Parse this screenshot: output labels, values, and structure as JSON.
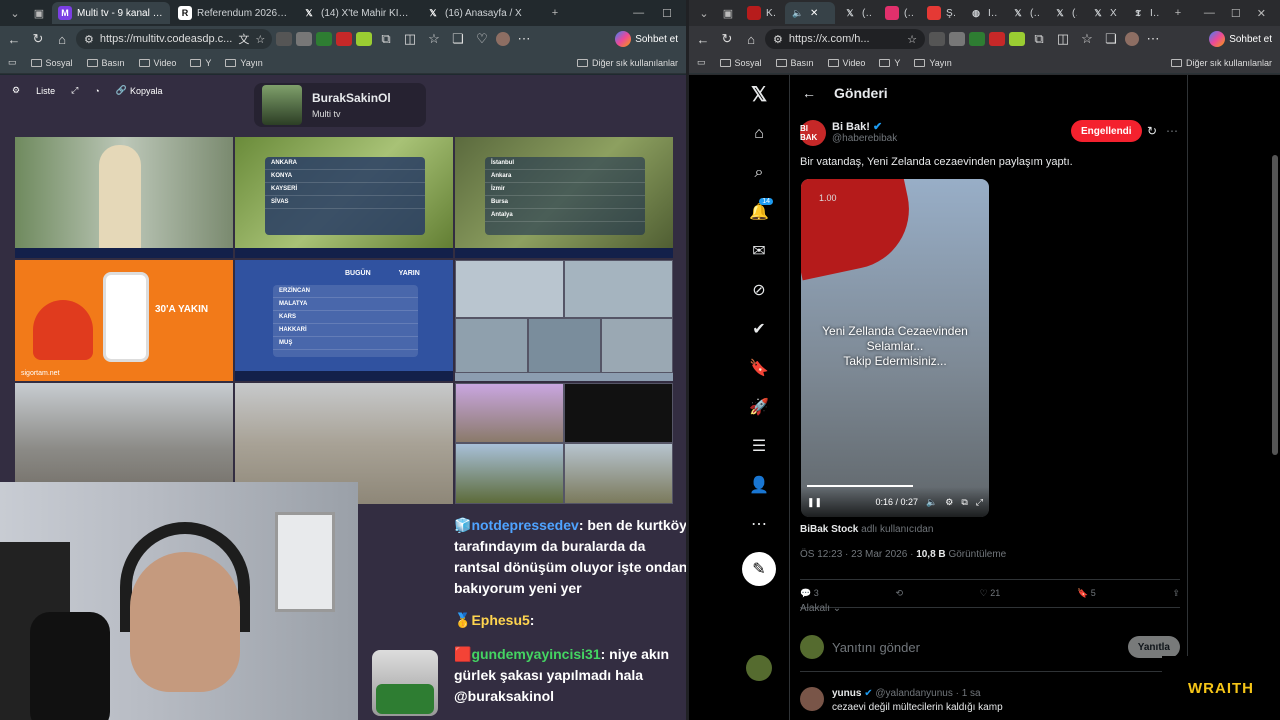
{
  "left_window": {
    "tabs": [
      {
        "label": "Multi tv - 9 kanal izleniy",
        "active": true
      },
      {
        "label": "Referendum 2026, oggi",
        "active": false
      },
      {
        "label": "(14) X'te Mahir KILIÇ: \"Ö",
        "active": false
      },
      {
        "label": "(16) Anasayfa / X",
        "active": false
      }
    ],
    "url": "https://multitv.codeasdp.c...",
    "chat_button": "Sohbet et",
    "bookmarks": [
      "Sosyal",
      "Basın",
      "Video",
      "Y",
      "Yayın"
    ],
    "other_bookmarks": "Diğer sık kullanılanlar"
  },
  "right_window": {
    "tabs": [
      "Kick",
      "(11)",
      "(9) In",
      "Şanlı",
      "İran",
      "(11)",
      "(9) B",
      "X'te",
      "İran"
    ],
    "url": "https://x.com/h...",
    "chat_button": "Sohbet et",
    "bookmarks": [
      "Sosyal",
      "Basın",
      "Video",
      "Y",
      "Yayın"
    ],
    "other_bookmarks": "Diğer sık kullanılanlar"
  },
  "multitv": {
    "toolbar": {
      "list": "Liste",
      "copy": "Kopyala"
    },
    "profile": {
      "name": "BurakSakinOl",
      "subtitle": "Multi tv"
    },
    "tiles": {
      "ad_text": "30'A YAKIN",
      "ad_site": "sigortam.net",
      "weather_cities_1": [
        "ANKARA",
        "KONYA",
        "KAYSERİ",
        "SİVAS"
      ],
      "weather_cities_2": [
        "İstanbul",
        "Ankara",
        "İzmir",
        "Bursa",
        "Antalya"
      ],
      "weather_cities_3": [
        "ERZİNCAN",
        "MALATYA",
        "KARS",
        "HAKKARİ",
        "MUŞ"
      ],
      "weather_header": [
        "BUGÜN",
        "YARIN"
      ]
    }
  },
  "chat": [
    {
      "user": "notdepressedev",
      "text": "ben de kurtköy tarafındayım da buralarda da rantsal dönüşüm oluyor işte ondan bakıyorum yeni yer",
      "color": "#4fa3ff"
    },
    {
      "user": "Ephesu5",
      "text": "",
      "color": "#ffd54f"
    },
    {
      "user": "gundemyayincisi31",
      "text": "niye akın gürlek şakası yapılmadı hala @buraksakinol",
      "color": "#44d462"
    }
  ],
  "x_post": {
    "header": "Gönderi",
    "author_name": "Bi Bak!",
    "author_handle": "@haberebibak",
    "avatar_text": "BI BAK",
    "blocked_label": "Engellendi",
    "text": "Bir vatandaş, Yeni Zelanda cezaevinden paylaşım yaptı.",
    "video": {
      "speed": "1.00",
      "caption_lines": [
        "Yeni Zellanda Cezaevinden",
        "Selamlar...",
        "Takip Edermisiniz..."
      ],
      "time": "0:16 / 0:27"
    },
    "source_user": "BiBak Stock",
    "source_suffix": "adlı kullanıcıdan",
    "time": "ÖS 12:23 · 23 Mar 2026 ·",
    "views": "10,8 B",
    "views_label": "Görüntüleme",
    "counts": {
      "replies": "3",
      "retweets": "",
      "likes": "21",
      "bookmarks": "5"
    },
    "related": "Alakalı",
    "reply_placeholder": "Yanıtını gönder",
    "reply_button": "Yanıtla",
    "notif_count": "14",
    "comment": {
      "name": "yunus",
      "handle": "@yalandanyunus · 1 sa",
      "text": "cezaevi değil mültecilerin kaldığı kamp"
    }
  },
  "overlay_brand": "WRAITH"
}
